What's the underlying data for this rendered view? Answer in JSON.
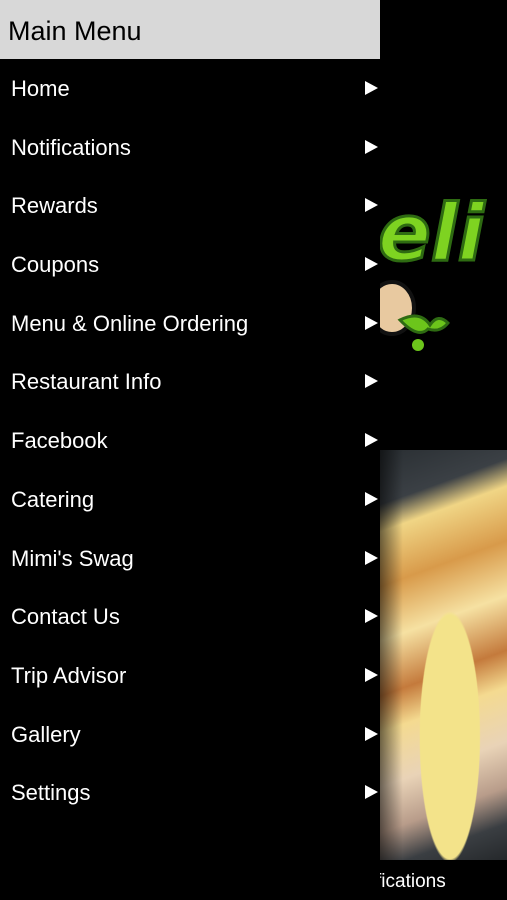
{
  "drawer": {
    "title": "Main Menu",
    "items": [
      {
        "label": "Home"
      },
      {
        "label": "Notifications"
      },
      {
        "label": "Rewards"
      },
      {
        "label": "Coupons"
      },
      {
        "label": "Menu & Online Ordering"
      },
      {
        "label": "Restaurant Info"
      },
      {
        "label": "Facebook"
      },
      {
        "label": "Catering"
      },
      {
        "label": "Mimi's Swag"
      },
      {
        "label": "Contact Us"
      },
      {
        "label": "Trip Advisor"
      },
      {
        "label": "Gallery"
      },
      {
        "label": "Settings"
      }
    ]
  },
  "background": {
    "logo_text": "eli",
    "bottom_tab_label": "fications"
  },
  "colors": {
    "header_bg": "#d8d8d8",
    "drawer_bg": "#000000",
    "logo_green": "#7ed321"
  }
}
